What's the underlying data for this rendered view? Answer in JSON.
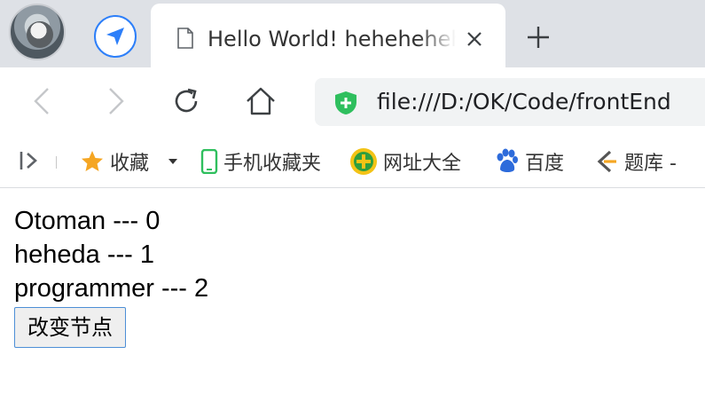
{
  "tab": {
    "title": "Hello World! hehehehehe",
    "close_symbol": "×"
  },
  "new_tab_symbol": "+",
  "toolbar": {
    "url": "file:///D:/OK/Code/frontEnd"
  },
  "bookmarks": {
    "items": [
      {
        "label": "收藏",
        "icon": "star-icon"
      },
      {
        "label": "手机收藏夹",
        "icon": "phone-icon"
      },
      {
        "label": "网址大全",
        "icon": "plus-badge-icon"
      },
      {
        "label": "百度",
        "icon": "baidu-paw-icon"
      },
      {
        "label": "题库 -",
        "icon": "tiku-icon"
      }
    ]
  },
  "content": {
    "lines": [
      "Otoman --- 0",
      "heheda --- 1",
      "programmer --- 2"
    ],
    "button_label": "改变节点"
  },
  "colors": {
    "tabstrip": "#dee1e6",
    "accent_blue": "#2d7ff9",
    "shield_green": "#2fbf5e",
    "star_orange": "#f5a623"
  }
}
